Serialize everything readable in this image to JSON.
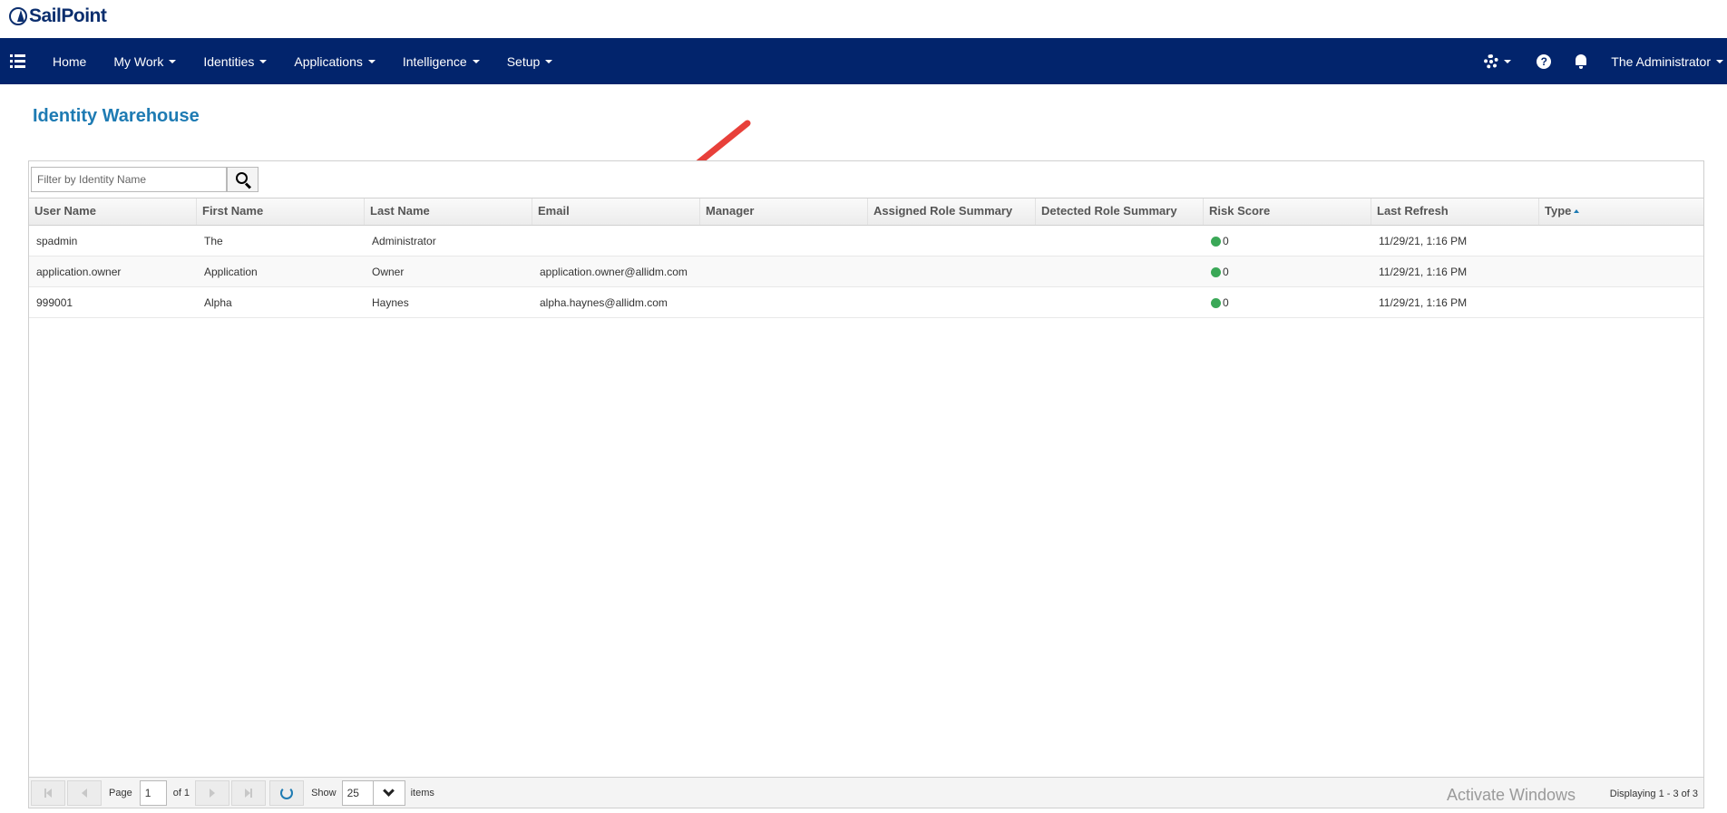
{
  "app": {
    "logo_text": "SailPoint"
  },
  "nav": {
    "items": [
      {
        "label": "Home",
        "has_dropdown": false
      },
      {
        "label": "My Work",
        "has_dropdown": true
      },
      {
        "label": "Identities",
        "has_dropdown": true
      },
      {
        "label": "Applications",
        "has_dropdown": true
      },
      {
        "label": "Intelligence",
        "has_dropdown": true
      },
      {
        "label": "Setup",
        "has_dropdown": true
      }
    ],
    "user_label": "The Administrator",
    "help_glyph": "?"
  },
  "page": {
    "title": "Identity Warehouse"
  },
  "filter": {
    "placeholder": "Filter by Identity Name"
  },
  "table": {
    "columns": [
      "User Name",
      "First Name",
      "Last Name",
      "Email",
      "Manager",
      "Assigned Role Summary",
      "Detected Role Summary",
      "Risk Score",
      "Last Refresh",
      "Type"
    ],
    "sorted_column": "Type",
    "rows": [
      [
        "spadmin",
        "The",
        "Administrator",
        "",
        "",
        "",
        "",
        "0",
        "11/29/21, 1:16 PM",
        ""
      ],
      [
        "application.owner",
        "Application",
        "Owner",
        "application.owner@allidm.com",
        "",
        "",
        "",
        "0",
        "11/29/21, 1:16 PM",
        ""
      ],
      [
        "999001",
        "Alpha",
        "Haynes",
        "alpha.haynes@allidm.com",
        "",
        "",
        "",
        "0",
        "11/29/21, 1:16 PM",
        ""
      ]
    ]
  },
  "pager": {
    "page_label": "Page",
    "page_value": "1",
    "of_label": "of 1",
    "show_label": "Show",
    "show_value": "25",
    "items_label": "items",
    "displaying": "Displaying 1 - 3 of 3"
  },
  "watermark": "Activate Windows",
  "colors": {
    "navbar": "#02246c",
    "title": "#1e7bb3",
    "risk_ok": "#3aa857",
    "annotation_arrow": "#e8403a"
  },
  "icons": [
    "menu-icon",
    "gear-icon",
    "help-icon",
    "bell-icon",
    "search-icon",
    "first-page-icon",
    "prev-page-icon",
    "next-page-icon",
    "last-page-icon",
    "refresh-icon",
    "chevron-down-icon"
  ]
}
